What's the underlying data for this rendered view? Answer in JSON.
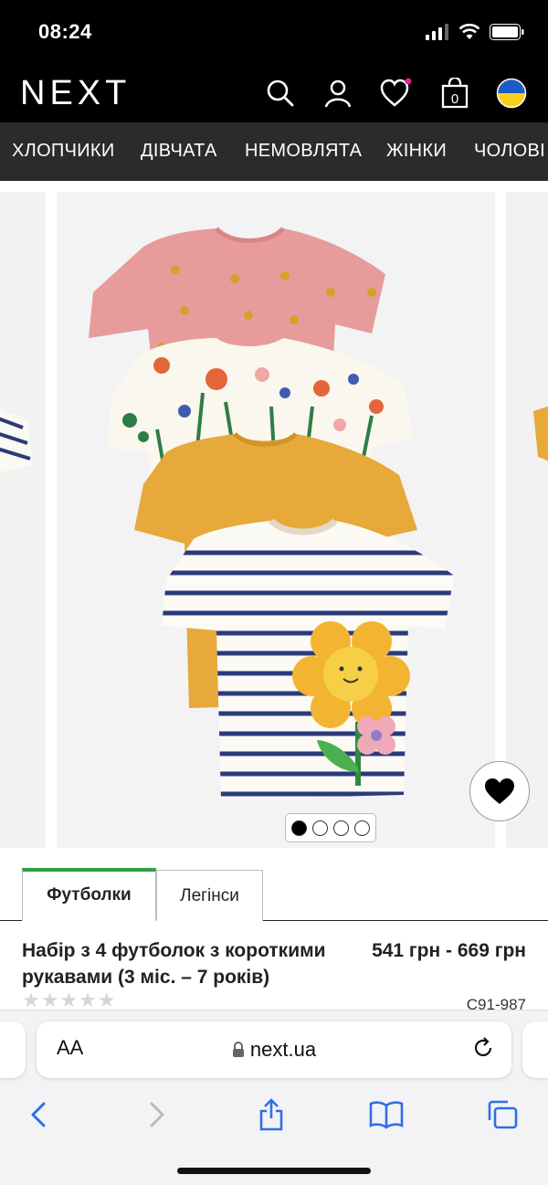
{
  "status_bar": {
    "time": "08:24"
  },
  "header": {
    "logo": "NEXT",
    "icons": [
      "search-icon",
      "account-icon",
      "wishlist-icon",
      "bag-icon",
      "ukraine-flag-icon"
    ],
    "bag_count": "0",
    "wishlist_dot_color": "#e0218a"
  },
  "nav": {
    "items": [
      {
        "label": "ХЛОПЧИКИ"
      },
      {
        "label": "ДІВЧАТА"
      },
      {
        "label": "НЕМОВЛЯТА"
      },
      {
        "label": "ЖІНКИ"
      },
      {
        "label": "ЧОЛОВІ"
      }
    ]
  },
  "gallery": {
    "image_alt": "4 t-shirts: pink with bees, white floral, mustard yellow, navy striped with flower",
    "dots_total": 4,
    "active_dot": 1
  },
  "tabs": [
    {
      "label": "Футболки",
      "active": true
    },
    {
      "label": "Легінси",
      "active": false
    }
  ],
  "product": {
    "title": "Набір з 4 футболок з короткими рукавами (3 міс. – 7 років)",
    "price": "541 грн - 669 грн",
    "code": "C91-987",
    "rating_stars": "★★★★★"
  },
  "browser": {
    "aa_label": "AA",
    "url": "next.ua"
  },
  "colors": {
    "header_bg": "#000000",
    "nav_bg": "#2b2b2b",
    "active_tab_accent": "#2f9e44"
  }
}
